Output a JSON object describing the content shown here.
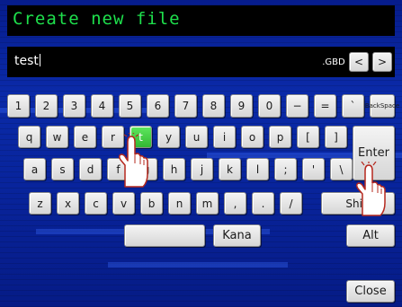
{
  "title": "Create new file",
  "filename": {
    "value": "test",
    "extension": ".GBD",
    "prev_label": "<",
    "next_label": ">"
  },
  "rows": {
    "row1": [
      "1",
      "2",
      "3",
      "4",
      "5",
      "6",
      "7",
      "8",
      "9",
      "0",
      "−",
      "=",
      "`"
    ],
    "backspace_line1": "Back",
    "backspace_line2": "Space",
    "row2": [
      "q",
      "w",
      "e",
      "r",
      "t",
      "y",
      "u",
      "i",
      "o",
      "p",
      "[",
      "]"
    ],
    "row3": [
      "a",
      "s",
      "d",
      "f",
      "g",
      "h",
      "j",
      "k",
      "l",
      ";",
      "'",
      "\\"
    ],
    "row4": [
      "z",
      "x",
      "c",
      "v",
      "b",
      "n",
      "m",
      ",",
      ".",
      "/"
    ],
    "shift_label": "Shift",
    "enter_label": "Enter"
  },
  "actions": {
    "kana_label": "Kana",
    "alt_label": "Alt",
    "close_label": "Close"
  },
  "highlight_key": "t",
  "colors": {
    "title_text": "#1ee04c",
    "highlight": "#33b833",
    "background": "#0a2aa8"
  }
}
